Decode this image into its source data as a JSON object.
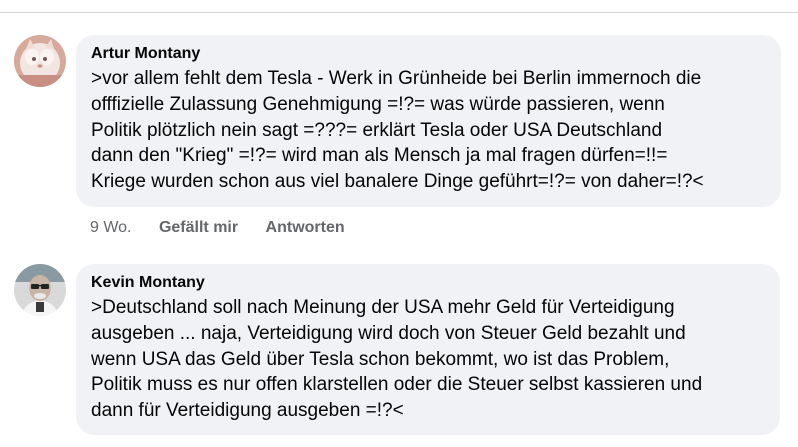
{
  "comments": [
    {
      "author": "Artur Montany",
      "text": ">vor allem fehlt dem Tesla - Werk in Grünheide bei Berlin immernoch die\nofffizielle Zulassung Genehmigung =!?= was würde passieren, wenn\nPolitik plötzlich nein sagt =???= erklärt Tesla oder USA Deutschland\ndann den \"Krieg\" =!?= wird man als Mensch ja mal fragen dürfen=!!=\nKriege wurden schon aus viel banalere Dinge geführt=!?= von daher=!?<",
      "time": "9 Wo.",
      "like_label": "Gefällt mir",
      "reply_label": "Antworten"
    },
    {
      "author": "Kevin Montany",
      "text": ">Deutschland soll nach Meinung der USA mehr Geld für Verteidigung\nausgeben ... naja, Verteidigung wird doch von Steuer Geld bezahlt und\nwenn USA das Geld über Tesla schon bekommt, wo ist das Problem,\nPolitik muss es nur offen klarstellen oder die Steuer selbst kassieren und\ndann für Verteidigung ausgeben =!?<"
    }
  ]
}
